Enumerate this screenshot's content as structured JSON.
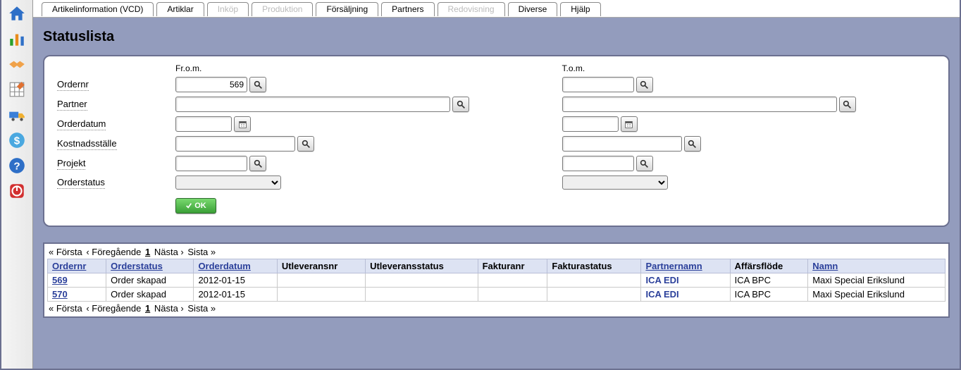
{
  "tabs": [
    "Artikelinformation (VCD)",
    "Artiklar",
    "Inköp",
    "Produktion",
    "Försäljning",
    "Partners",
    "Redovisning",
    "Diverse",
    "Hjälp"
  ],
  "tabs_disabled": [
    false,
    false,
    true,
    true,
    false,
    false,
    true,
    false,
    false
  ],
  "title": "Statuslista",
  "form": {
    "col_from": "Fr.o.m.",
    "col_to": "T.o.m.",
    "labels": {
      "ordernr": "Ordernr",
      "partner": "Partner",
      "orderdatum": "Orderdatum",
      "kostnad": "Kostnadsställe",
      "projekt": "Projekt",
      "orderstatus": "Orderstatus"
    },
    "values": {
      "from_ordernr": "569",
      "to_ordernr": "",
      "from_partner": "",
      "to_partner": "",
      "from_orderdatum": "",
      "to_orderdatum": "",
      "from_kostnad": "",
      "to_kostnad": "",
      "from_projekt": "",
      "to_projekt": "",
      "from_status": "",
      "to_status": ""
    },
    "ok": "OK"
  },
  "pager": {
    "first": "« Första",
    "prev": "‹ Föregående",
    "page": "1",
    "next": "Nästa ›",
    "last": "Sista »"
  },
  "headers": {
    "ordernr": "Ordernr",
    "orderstatus": "Orderstatus",
    "orderdatum": "Orderdatum",
    "utleveransnr": "Utleveransnr",
    "utleveransstatus": "Utleveransstatus",
    "fakturanr": "Fakturanr",
    "fakturastatus": "Fakturastatus",
    "partnernamn": "Partnernamn",
    "affarsflode": "Affärsflöde",
    "namn": "Namn"
  },
  "rows": [
    {
      "ordernr": "569",
      "orderstatus": "Order skapad",
      "orderdatum": "2012-01-15",
      "utleveransnr": "",
      "utleveransstatus": "",
      "fakturanr": "",
      "fakturastatus": "",
      "partnernamn": "ICA EDI",
      "affarsflode": "ICA BPC",
      "namn": "Maxi Special Erikslund"
    },
    {
      "ordernr": "570",
      "orderstatus": "Order skapad",
      "orderdatum": "2012-01-15",
      "utleveransnr": "",
      "utleveransstatus": "",
      "fakturanr": "",
      "fakturastatus": "",
      "partnernamn": "ICA EDI",
      "affarsflode": "ICA BPC",
      "namn": "Maxi Special Erikslund"
    }
  ]
}
